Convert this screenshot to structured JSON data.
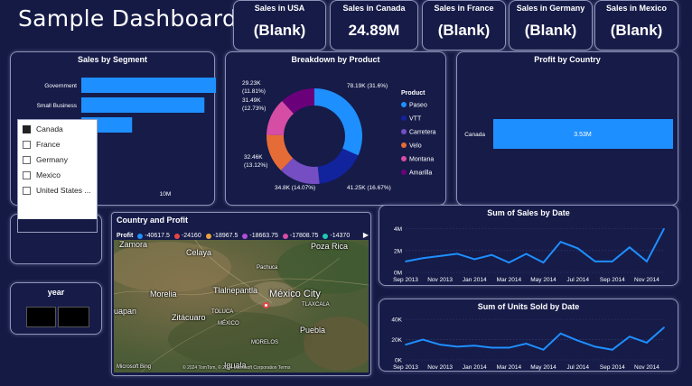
{
  "header": {
    "title": "Sample Dashboard"
  },
  "kpis": [
    {
      "title": "Sales in USA",
      "value": "(Blank)"
    },
    {
      "title": "Sales in Canada",
      "value": "24.89M"
    },
    {
      "title": "Sales in France",
      "value": "(Blank)"
    },
    {
      "title": "Sales in Germany",
      "value": "(Blank)"
    },
    {
      "title": "Sales in Mexico",
      "value": "(Blank)"
    }
  ],
  "segment": {
    "title": "Sales by Segment",
    "tick": "10M",
    "chart_data": {
      "type": "bar",
      "orientation": "horizontal",
      "categories": [
        "Government",
        "Small Business",
        ""
      ],
      "values": [
        12.0,
        10.9,
        4.5
      ],
      "xlim": [
        0,
        14
      ],
      "color": "#1e8fff"
    }
  },
  "country_slicer": {
    "options": [
      {
        "label": "Canada",
        "checked": true
      },
      {
        "label": "France",
        "checked": false
      },
      {
        "label": "Germany",
        "checked": false
      },
      {
        "label": "Mexico",
        "checked": false
      },
      {
        "label": "United States ...",
        "checked": false
      }
    ]
  },
  "year_slicer": {
    "title": "year"
  },
  "product": {
    "title": "Breakdown by Product",
    "legend_title": "Product",
    "chart_data": {
      "type": "pie",
      "donut": true,
      "slices": [
        {
          "name": "Paseo",
          "value": 78190,
          "label": "78.19K (31.6%)",
          "color": "#1e8fff"
        },
        {
          "name": "VTT",
          "value": 41250,
          "label": "41.25K (16.67%)",
          "color": "#12239e"
        },
        {
          "name": "Carretera",
          "value": 34800,
          "label": "34.8K (14.07%)",
          "color": "#744ec2"
        },
        {
          "name": "Velo",
          "value": 32460,
          "label": "32.46K (13.12%)",
          "color": "#e66c37"
        },
        {
          "name": "Montana",
          "value": 31490,
          "label": "31.49K (12.73%)",
          "color": "#d64da6"
        },
        {
          "name": "Amarilla",
          "value": 29230,
          "label": "29.23K (11.81%)",
          "color": "#6b007b"
        }
      ]
    }
  },
  "profit_country": {
    "title": "Profit by Country",
    "chart_data": {
      "type": "bar",
      "orientation": "horizontal",
      "categories": [
        "Canada"
      ],
      "values": [
        3.53
      ],
      "data_labels": [
        "3.53M"
      ],
      "color": "#1e8fff"
    }
  },
  "map": {
    "title": "Country and Profit",
    "legend_label": "Profit",
    "legend_items": [
      {
        "label": "-40617.5",
        "color": "#1e8fff"
      },
      {
        "label": "-24160",
        "color": "#e84545"
      },
      {
        "label": "-18967.5",
        "color": "#e8a33d"
      },
      {
        "label": "-18663.75",
        "color": "#b04fd6"
      },
      {
        "label": "-17808.75",
        "color": "#d64da6"
      },
      {
        "label": "-14370",
        "color": "#1ec9b0"
      }
    ],
    "places": {
      "zamora": "Zamora",
      "poza_rica": "Poza Rica",
      "celaya": "Celaya",
      "pachuca": "Pachuca",
      "morelia": "Morelia",
      "tlalnepantla": "Tlalnepantla",
      "mexico_city": "México City",
      "uapan": "uapan",
      "zitacuaro": "Zitácuaro",
      "toluca": "TOLUCA",
      "mexico_state": "MÉXICO",
      "tlaxcala": "TLAXCALA",
      "puebla": "Puebla",
      "morelos": "MORELOS",
      "iguala": "Iguala",
      "credits": "© 2024 TomTom, © 2024 Microsoft Corporation Terms",
      "bing": "Microsoft Bing"
    }
  },
  "sales_date": {
    "title": "Sum of Sales by Date",
    "chart_data": {
      "type": "line",
      "x": [
        "2013-09",
        "2013-10",
        "2013-11",
        "2013-12",
        "2014-01",
        "2014-02",
        "2014-03",
        "2014-04",
        "2014-05",
        "2014-06",
        "2014-07",
        "2014-08",
        "2014-09",
        "2014-10",
        "2014-11",
        "2014-12"
      ],
      "y": [
        1.0,
        1.3,
        1.5,
        1.7,
        1.2,
        1.6,
        0.9,
        1.7,
        0.9,
        2.8,
        2.2,
        1.0,
        1.0,
        2.3,
        1.0,
        4.0
      ],
      "ylim": [
        0,
        4.3
      ],
      "yticks": [
        "0M",
        "2M",
        "4M"
      ],
      "xticks": [
        "Sep 2013",
        "Nov 2013",
        "Jan 2014",
        "Mar 2014",
        "May 2014",
        "Jul 2014",
        "Sep 2014",
        "Nov 2014"
      ],
      "color": "#1e8fff"
    }
  },
  "units_date": {
    "title": "Sum of Units Sold by Date",
    "chart_data": {
      "type": "line",
      "x": [
        "2013-09",
        "2013-10",
        "2013-11",
        "2013-12",
        "2014-01",
        "2014-02",
        "2014-03",
        "2014-04",
        "2014-05",
        "2014-06",
        "2014-07",
        "2014-08",
        "2014-09",
        "2014-10",
        "2014-11",
        "2014-12"
      ],
      "y": [
        15000,
        20000,
        15000,
        13000,
        14000,
        12000,
        12000,
        16000,
        10000,
        26000,
        19000,
        13000,
        10000,
        23000,
        17000,
        32000
      ],
      "ylim": [
        0,
        41000
      ],
      "yticks": [
        "0K",
        "20K",
        "40K"
      ],
      "xticks": [
        "Sep 2013",
        "Nov 2013",
        "Jan 2014",
        "Mar 2014",
        "May 2014",
        "Jul 2014",
        "Sep 2014",
        "Nov 2014"
      ],
      "color": "#1e8fff"
    }
  }
}
